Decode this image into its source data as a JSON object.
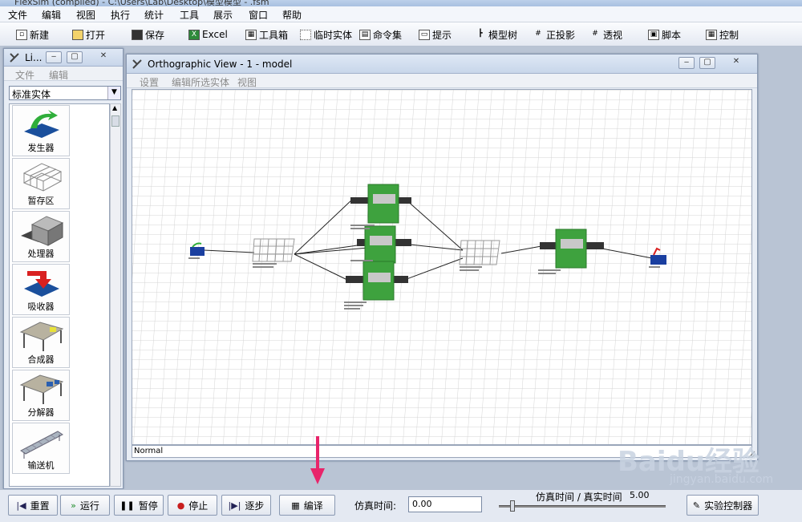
{
  "app": {
    "title_fragment": "FlexSim (compiled) - C:\\Users\\Lab\\Desktop\\模型模型 - .fsm"
  },
  "menubar": [
    "文件",
    "编辑",
    "视图",
    "执行",
    "统计",
    "工具",
    "展示",
    "窗口",
    "帮助"
  ],
  "toolbar": [
    {
      "label": "新建",
      "icon": "new-file-icon"
    },
    {
      "label": "打开",
      "icon": "open-folder-icon"
    },
    {
      "label": "保存",
      "icon": "save-disk-icon"
    },
    {
      "label": "Excel",
      "icon": "excel-icon"
    },
    {
      "label": "工具箱",
      "icon": "toolbox-icon"
    },
    {
      "label": "临时实体",
      "icon": "flowitem-icon"
    },
    {
      "label": "命令集",
      "icon": "command-icon"
    },
    {
      "label": "提示",
      "icon": "hint-icon"
    },
    {
      "label": "模型树",
      "icon": "model-tree-icon"
    },
    {
      "label": "正投影",
      "icon": "ortho-icon"
    },
    {
      "label": "透视",
      "icon": "perspective-icon"
    },
    {
      "label": "脚本",
      "icon": "script-icon"
    },
    {
      "label": "控制",
      "icon": "control-icon"
    }
  ],
  "library": {
    "title": "Li...",
    "menu": [
      "文件",
      "编辑"
    ],
    "selected": "标准实体",
    "items": [
      "发生器",
      "暂存区",
      "处理器",
      "吸收器",
      "合成器",
      "分解器",
      "输送机"
    ]
  },
  "view": {
    "title": "Orthographic View - 1 - model",
    "menu": [
      "设置",
      "编辑所选实体",
      "视图"
    ],
    "status": "Normal"
  },
  "bottom": {
    "buttons": [
      {
        "label": "重置",
        "icon": "reset-icon"
      },
      {
        "label": "运行",
        "icon": "run-icon"
      },
      {
        "label": "暂停",
        "icon": "pause-icon"
      },
      {
        "label": "停止",
        "icon": "stop-icon"
      },
      {
        "label": "逐步",
        "icon": "step-icon"
      },
      {
        "label": "编译",
        "icon": "compile-icon"
      },
      {
        "label": "实验控制器",
        "icon": "experimenter-icon"
      }
    ],
    "sim_time_label": "仿真时间:",
    "sim_time_value": "0.00",
    "ratio_label": "仿真时间 / 真实时间",
    "ratio_value": "5.00"
  },
  "watermark": {
    "main": "Baidu经验",
    "sub": "jingyan.baidu.com"
  }
}
